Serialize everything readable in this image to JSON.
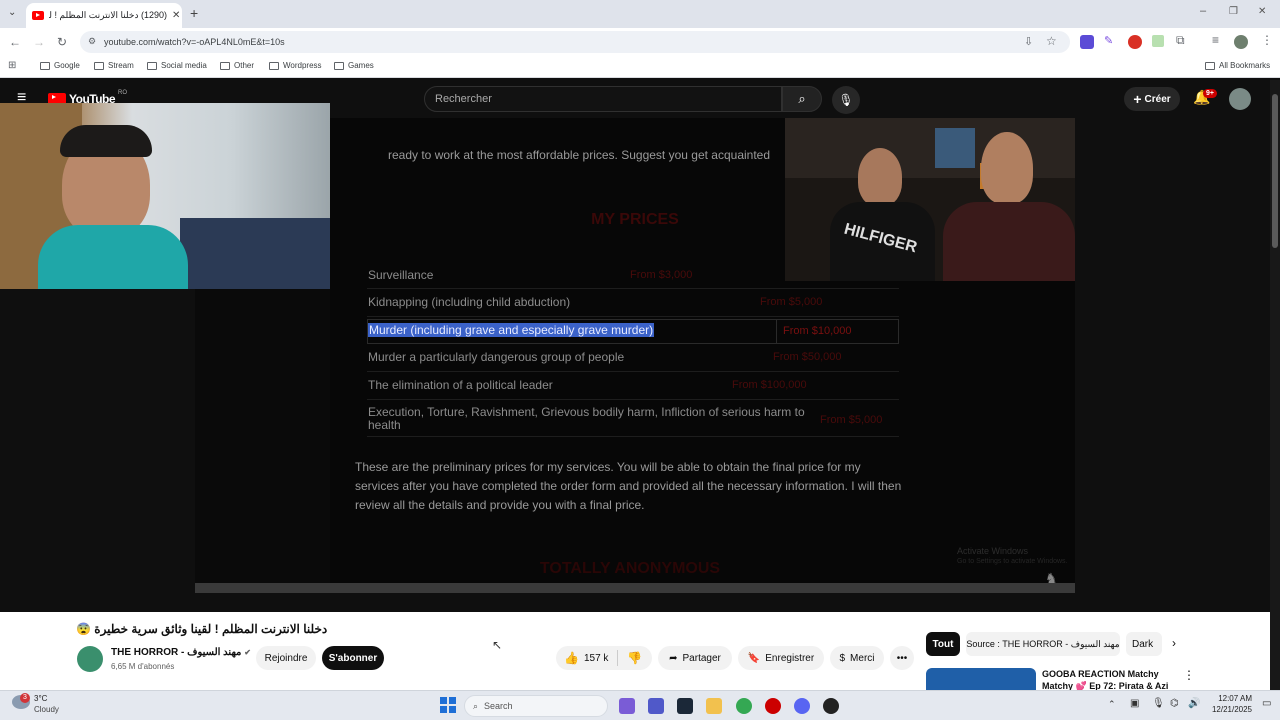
{
  "browser": {
    "tab_title": "(1290) دخلنا الانترنت المظلم ! لقـ",
    "new_tab": "+",
    "url": "youtube.com/watch?v=-oAPL4NL0mE&t=10s",
    "bookmarks": [
      "Google",
      "Stream",
      "Social media",
      "Other",
      "Wordpress",
      "Games"
    ],
    "all_bookmarks": "All Bookmarks"
  },
  "youtube": {
    "logo_text": "YouTube",
    "logo_region": "RO",
    "search_placeholder": "Rechercher",
    "create_label": "Créer",
    "notifications_badge": "9+"
  },
  "video_content": {
    "intro_line": "ready to work at the most affordable prices. Suggest you get acquainted",
    "prices_heading": "MY PRICES",
    "rows": [
      {
        "service": "Surveillance",
        "price": "From $3,000"
      },
      {
        "service": "Kidnapping (including child abduction)",
        "price": "From $5,000"
      },
      {
        "service": "Murder (including grave and especially grave murder)",
        "price": "From $10,000"
      },
      {
        "service": "Murder a particularly dangerous group of people",
        "price": "From $50,000"
      },
      {
        "service": "The elimination of a political leader",
        "price": "From $100,000"
      },
      {
        "service": "Execution, Torture, Ravishment, Grievous bodily harm, Infliction of serious harm to health",
        "price": "From $5,000"
      }
    ],
    "paragraph": "These are the preliminary prices for my services. You will be able to obtain the final price for my services after you have completed the order form and provided all the necessary information. I will then review all the details and provide you with a final price.",
    "bottom_heading": "TOTALLY ANONYMOUS",
    "watermark_line1": "Activate Windows",
    "watermark_line2": "Go to Settings to activate Windows."
  },
  "inset_shirt_text": "HILFIGER",
  "video_meta": {
    "title": "دخلنا الانترنت المظلم ! لقينا وثائق سرية خطيرة 😨",
    "channel_name": "THE HORROR - مهند السيوف",
    "subscribers": "6,65 M d'abonnés",
    "join_label": "Rejoindre",
    "subscribe_label": "S'abonner",
    "likes": "157 k",
    "share_label": "Partager",
    "save_label": "Enregistrer",
    "thanks_label": "Merci",
    "more_label": "•••"
  },
  "sidebar": {
    "chips": [
      "Tout",
      "Source : THE HORROR - مهند السيوف",
      "Dark"
    ],
    "rec_title": "GOOBA REACTION Matchy Matchy 💕 Ep 72: Pirata & Azi"
  },
  "taskbar": {
    "weather_temp": "3°C",
    "weather_text": "Cloudy",
    "weather_badge": "3",
    "search_label": "Search",
    "time": "12:07 AM",
    "date": "12/21/2025"
  }
}
